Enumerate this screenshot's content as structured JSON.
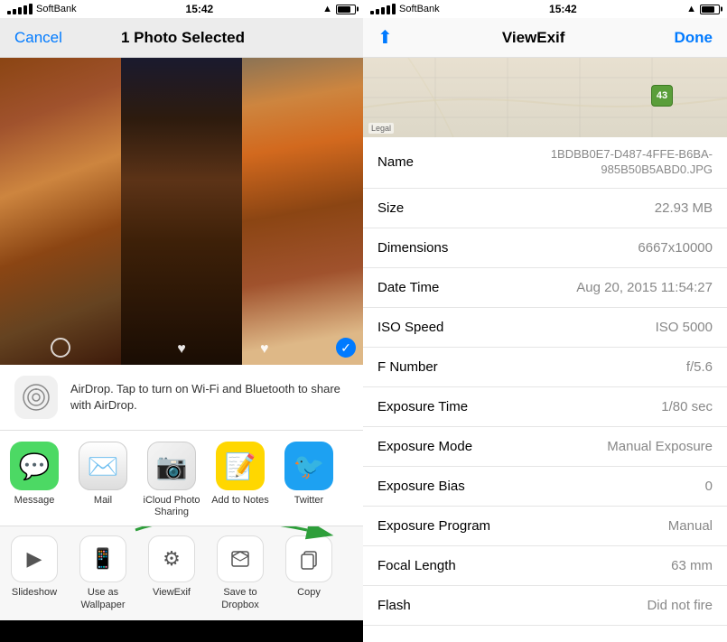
{
  "left": {
    "status": {
      "carrier": "SoftBank",
      "time": "15:42",
      "battery_label": "battery"
    },
    "nav": {
      "cancel": "Cancel",
      "title": "1 Photo Selected"
    },
    "airdrop": {
      "text": "AirDrop. Tap to turn on Wi-Fi and Bluetooth to share with AirDrop."
    },
    "apps": [
      {
        "label": "Message",
        "icon": "💬",
        "class": "app-icon-message"
      },
      {
        "label": "Mail",
        "icon": "✉️",
        "class": "app-icon-mail"
      },
      {
        "label": "iCloud Photo\nSharing",
        "icon": "📷",
        "class": "app-icon-icloud"
      },
      {
        "label": "Add to Notes",
        "icon": "📝",
        "class": "app-icon-notes"
      },
      {
        "label": "Twitter",
        "icon": "🐦",
        "class": "app-icon-twitter"
      }
    ],
    "actions": [
      {
        "label": "Slideshow",
        "icon": "▶"
      },
      {
        "label": "Use as\nWallpaper",
        "icon": "📱"
      },
      {
        "label": "ViewExif",
        "icon": "⚙"
      },
      {
        "label": "Save to\nDropbox",
        "icon": "📦"
      },
      {
        "label": "Copy",
        "icon": "📋"
      }
    ]
  },
  "right": {
    "status": {
      "carrier": "SoftBank",
      "time": "15:42",
      "battery_label": "battery"
    },
    "nav": {
      "title": "ViewExif",
      "done": "Done"
    },
    "map": {
      "legal": "Legal",
      "pin_number": "43"
    },
    "exif": [
      {
        "label": "Name",
        "value": "1BDBB0E7-D487-4FFE-B6BA-985B50B5ABD0.JPG",
        "small": true
      },
      {
        "label": "Size",
        "value": "22.93 MB"
      },
      {
        "label": "Dimensions",
        "value": "6667x10000"
      },
      {
        "label": "Date Time",
        "value": "Aug 20, 2015 11:54:27"
      },
      {
        "label": "ISO Speed",
        "value": "ISO 5000"
      },
      {
        "label": "F Number",
        "value": "f/5.6"
      },
      {
        "label": "Exposure Time",
        "value": "1/80 sec"
      },
      {
        "label": "Exposure Mode",
        "value": "Manual Exposure"
      },
      {
        "label": "Exposure Bias",
        "value": "0"
      },
      {
        "label": "Exposure Program",
        "value": "Manual"
      },
      {
        "label": "Focal Length",
        "value": "63 mm"
      },
      {
        "label": "Flash",
        "value": "Did not fire"
      }
    ]
  }
}
